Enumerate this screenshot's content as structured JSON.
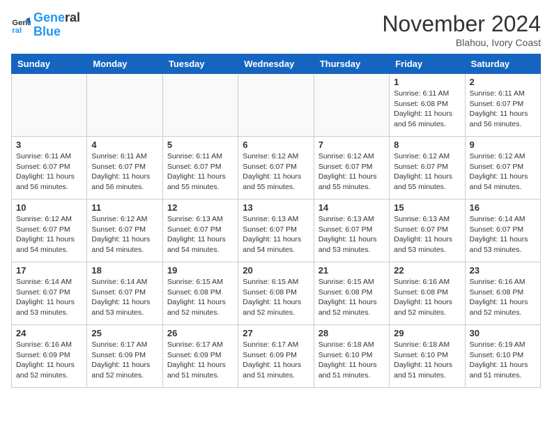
{
  "header": {
    "logo_line1": "General",
    "logo_line2": "Blue",
    "month": "November 2024",
    "location": "Blahou, Ivory Coast"
  },
  "weekdays": [
    "Sunday",
    "Monday",
    "Tuesday",
    "Wednesday",
    "Thursday",
    "Friday",
    "Saturday"
  ],
  "weeks": [
    [
      {
        "day": "",
        "info": ""
      },
      {
        "day": "",
        "info": ""
      },
      {
        "day": "",
        "info": ""
      },
      {
        "day": "",
        "info": ""
      },
      {
        "day": "",
        "info": ""
      },
      {
        "day": "1",
        "info": "Sunrise: 6:11 AM\nSunset: 6:08 PM\nDaylight: 11 hours and 56 minutes."
      },
      {
        "day": "2",
        "info": "Sunrise: 6:11 AM\nSunset: 6:07 PM\nDaylight: 11 hours and 56 minutes."
      }
    ],
    [
      {
        "day": "3",
        "info": "Sunrise: 6:11 AM\nSunset: 6:07 PM\nDaylight: 11 hours and 56 minutes."
      },
      {
        "day": "4",
        "info": "Sunrise: 6:11 AM\nSunset: 6:07 PM\nDaylight: 11 hours and 56 minutes."
      },
      {
        "day": "5",
        "info": "Sunrise: 6:11 AM\nSunset: 6:07 PM\nDaylight: 11 hours and 55 minutes."
      },
      {
        "day": "6",
        "info": "Sunrise: 6:12 AM\nSunset: 6:07 PM\nDaylight: 11 hours and 55 minutes."
      },
      {
        "day": "7",
        "info": "Sunrise: 6:12 AM\nSunset: 6:07 PM\nDaylight: 11 hours and 55 minutes."
      },
      {
        "day": "8",
        "info": "Sunrise: 6:12 AM\nSunset: 6:07 PM\nDaylight: 11 hours and 55 minutes."
      },
      {
        "day": "9",
        "info": "Sunrise: 6:12 AM\nSunset: 6:07 PM\nDaylight: 11 hours and 54 minutes."
      }
    ],
    [
      {
        "day": "10",
        "info": "Sunrise: 6:12 AM\nSunset: 6:07 PM\nDaylight: 11 hours and 54 minutes."
      },
      {
        "day": "11",
        "info": "Sunrise: 6:12 AM\nSunset: 6:07 PM\nDaylight: 11 hours and 54 minutes."
      },
      {
        "day": "12",
        "info": "Sunrise: 6:13 AM\nSunset: 6:07 PM\nDaylight: 11 hours and 54 minutes."
      },
      {
        "day": "13",
        "info": "Sunrise: 6:13 AM\nSunset: 6:07 PM\nDaylight: 11 hours and 54 minutes."
      },
      {
        "day": "14",
        "info": "Sunrise: 6:13 AM\nSunset: 6:07 PM\nDaylight: 11 hours and 53 minutes."
      },
      {
        "day": "15",
        "info": "Sunrise: 6:13 AM\nSunset: 6:07 PM\nDaylight: 11 hours and 53 minutes."
      },
      {
        "day": "16",
        "info": "Sunrise: 6:14 AM\nSunset: 6:07 PM\nDaylight: 11 hours and 53 minutes."
      }
    ],
    [
      {
        "day": "17",
        "info": "Sunrise: 6:14 AM\nSunset: 6:07 PM\nDaylight: 11 hours and 53 minutes."
      },
      {
        "day": "18",
        "info": "Sunrise: 6:14 AM\nSunset: 6:07 PM\nDaylight: 11 hours and 53 minutes."
      },
      {
        "day": "19",
        "info": "Sunrise: 6:15 AM\nSunset: 6:08 PM\nDaylight: 11 hours and 52 minutes."
      },
      {
        "day": "20",
        "info": "Sunrise: 6:15 AM\nSunset: 6:08 PM\nDaylight: 11 hours and 52 minutes."
      },
      {
        "day": "21",
        "info": "Sunrise: 6:15 AM\nSunset: 6:08 PM\nDaylight: 11 hours and 52 minutes."
      },
      {
        "day": "22",
        "info": "Sunrise: 6:16 AM\nSunset: 6:08 PM\nDaylight: 11 hours and 52 minutes."
      },
      {
        "day": "23",
        "info": "Sunrise: 6:16 AM\nSunset: 6:08 PM\nDaylight: 11 hours and 52 minutes."
      }
    ],
    [
      {
        "day": "24",
        "info": "Sunrise: 6:16 AM\nSunset: 6:09 PM\nDaylight: 11 hours and 52 minutes."
      },
      {
        "day": "25",
        "info": "Sunrise: 6:17 AM\nSunset: 6:09 PM\nDaylight: 11 hours and 52 minutes."
      },
      {
        "day": "26",
        "info": "Sunrise: 6:17 AM\nSunset: 6:09 PM\nDaylight: 11 hours and 51 minutes."
      },
      {
        "day": "27",
        "info": "Sunrise: 6:17 AM\nSunset: 6:09 PM\nDaylight: 11 hours and 51 minutes."
      },
      {
        "day": "28",
        "info": "Sunrise: 6:18 AM\nSunset: 6:10 PM\nDaylight: 11 hours and 51 minutes."
      },
      {
        "day": "29",
        "info": "Sunrise: 6:18 AM\nSunset: 6:10 PM\nDaylight: 11 hours and 51 minutes."
      },
      {
        "day": "30",
        "info": "Sunrise: 6:19 AM\nSunset: 6:10 PM\nDaylight: 11 hours and 51 minutes."
      }
    ]
  ]
}
